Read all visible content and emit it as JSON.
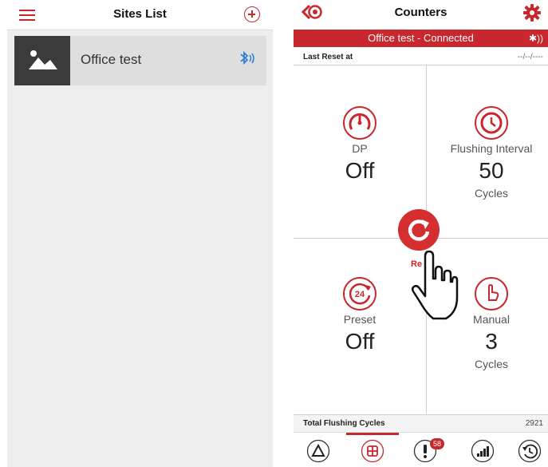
{
  "left": {
    "header": {
      "title": "Sites List"
    },
    "sites": [
      {
        "name": "Office test"
      }
    ]
  },
  "right": {
    "header": {
      "title": "Counters"
    },
    "status": {
      "text": "Office test - Connected"
    },
    "reset": {
      "label": "Last Reset at",
      "value": "--/--/----"
    },
    "counters": [
      {
        "label": "DP",
        "value": "Off",
        "unit": ""
      },
      {
        "label": "Flushing Interval",
        "value": "50",
        "unit": "Cycles"
      },
      {
        "label": "Preset",
        "value": "Off",
        "unit": ""
      },
      {
        "label": "Manual",
        "value": "3",
        "unit": "Cycles"
      }
    ],
    "reset_button": {
      "label": "Re"
    },
    "preset_icon_text": "24",
    "total": {
      "label": "Total Flushing Cycles",
      "value": "2921"
    },
    "nav": {
      "badge": "58"
    }
  },
  "colors": {
    "accent": "#c8282d",
    "bluetooth": "#2f7ed8"
  }
}
